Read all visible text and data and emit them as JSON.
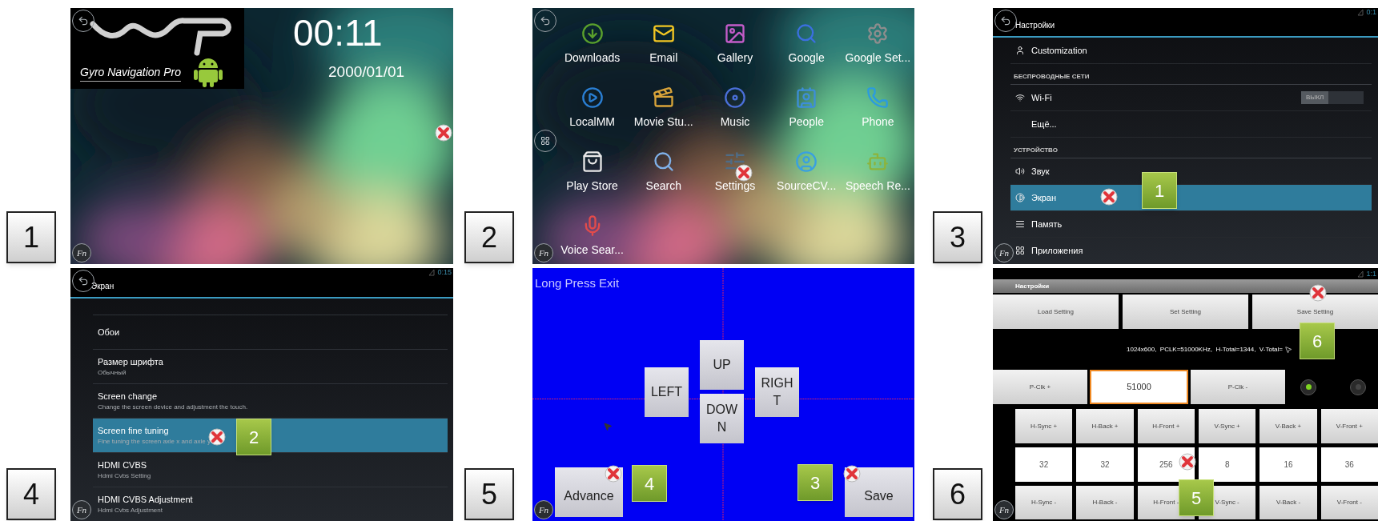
{
  "panels": [
    {
      "kind": "home",
      "step": "1",
      "logo_text": "Gyro Navigation Pro",
      "time": "00:11",
      "date": "2000/01/01",
      "fn": "Fn"
    },
    {
      "kind": "apps",
      "step": "2",
      "fn": "Fn",
      "apps": [
        "Downloads",
        "Email",
        "Gallery",
        "Google",
        "Google Set...",
        "LocalMM",
        "Movie Stu...",
        "Music",
        "People",
        "Phone",
        "Play Store",
        "Search",
        "Settings",
        "SourceCV...",
        "Speech Re...",
        "Voice Sear..."
      ]
    },
    {
      "kind": "settings",
      "step": "3",
      "title": "Настройки",
      "status_time": "0:1",
      "fn": "Fn",
      "rows": [
        {
          "kind": "item",
          "label": "Customization",
          "selected": false
        },
        {
          "kind": "header",
          "label": "БЕСПРОВОДНЫЕ СЕТИ"
        },
        {
          "kind": "item",
          "label": "Wi-Fi",
          "selected": false,
          "toggle": {
            "label": "ВЫКЛ",
            "on": false
          }
        },
        {
          "kind": "item",
          "label": "Ещё...",
          "selected": false
        },
        {
          "kind": "header",
          "label": "УСТРОЙСТВО"
        },
        {
          "kind": "item",
          "label": "Звук",
          "selected": false
        },
        {
          "kind": "item",
          "label": "Экран",
          "selected": true
        },
        {
          "kind": "item",
          "label": "Память",
          "selected": false
        },
        {
          "kind": "item",
          "label": "Приложения",
          "selected": false
        }
      ],
      "callouts": [
        {
          "number": "1"
        }
      ]
    },
    {
      "kind": "display",
      "step": "4",
      "title": "Экран",
      "status_time": "0:15",
      "fn": "Fn",
      "rows": [
        {
          "title": "Обои",
          "selected": false
        },
        {
          "title": "Размер шрифта",
          "subtitle": "Обычный",
          "selected": false
        },
        {
          "title": "Screen change",
          "subtitle": "Change the screen device and adjustment the touch.",
          "selected": false
        },
        {
          "title": "Screen fine tuning",
          "subtitle": "Fine tuning the screen axle x and axle y",
          "selected": true
        },
        {
          "title": "HDMI CVBS",
          "subtitle": "Hdmi Cvbs Setting",
          "selected": false
        },
        {
          "title": "HDMI CVBS Adjustment",
          "subtitle": "Hdmi Cvbs Adjustment",
          "selected": false
        }
      ],
      "callouts": [
        {
          "number": "2"
        }
      ]
    },
    {
      "kind": "calibration",
      "step": "5",
      "hint": "Long Press Exit",
      "pad": {
        "up": "UP",
        "left": "LEFT",
        "down": "DOWN",
        "right": "RIGHT"
      },
      "advance": "Advance",
      "save": "Save",
      "fn": "Fn",
      "callouts": [
        {
          "number": "4"
        },
        {
          "number": "3"
        }
      ]
    },
    {
      "kind": "timing",
      "step": "6",
      "title": "Настройки",
      "status_time": "1:1",
      "fn": "Fn",
      "top_buttons": [
        "Load Setting",
        "Set Setting",
        "Save Setting"
      ],
      "info": "1024x600,  PCLK=51000KHz,  H-Total=1344,  V-Total=",
      "pclk_plus": "P-Clk +",
      "pclk_value": "51000",
      "pclk_minus": "P-Clk -",
      "radios": [
        {
          "selected": true
        },
        {
          "selected": false
        }
      ],
      "plus_buttons": [
        "H-Sync +",
        "H-Back +",
        "H-Front +",
        "V-Sync +",
        "V-Back +",
        "V-Front +"
      ],
      "values": [
        "32",
        "32",
        "256",
        "8",
        "16",
        "36"
      ],
      "minus_buttons": [
        "H-Sync -",
        "H-Back -",
        "H-Front -",
        "V-Sync -",
        "V-Back -",
        "V-Front -"
      ],
      "callouts": [
        {
          "number": "6"
        },
        {
          "number": "5"
        }
      ]
    }
  ]
}
